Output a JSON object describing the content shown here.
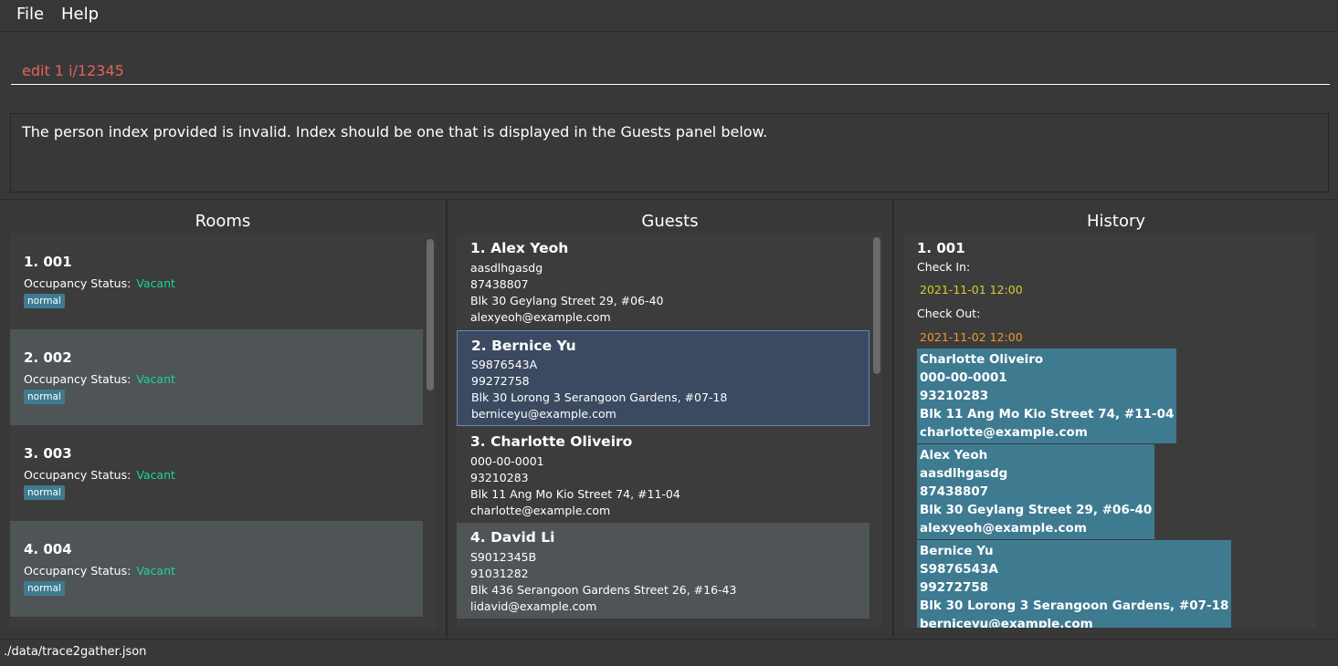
{
  "menu": {
    "file": "File",
    "help": "Help"
  },
  "command": {
    "value": "edit 1 i/12345"
  },
  "result": {
    "message": "The person index provided is invalid. Index should be one that is displayed in the Guests panel below."
  },
  "panels": {
    "rooms": "Rooms",
    "guests": "Guests",
    "history": "History"
  },
  "rooms": [
    {
      "title": "1.  001",
      "occupancy_label": "Occupancy Status:",
      "occupancy_value": "Vacant",
      "tag": "normal"
    },
    {
      "title": "2.  002",
      "occupancy_label": "Occupancy Status:",
      "occupancy_value": "Vacant",
      "tag": "normal"
    },
    {
      "title": "3.  003",
      "occupancy_label": "Occupancy Status:",
      "occupancy_value": "Vacant",
      "tag": "normal"
    },
    {
      "title": "4.  004",
      "occupancy_label": "Occupancy Status:",
      "occupancy_value": "Vacant",
      "tag": "normal"
    }
  ],
  "guests": [
    {
      "name": "1.  Alex Yeoh",
      "id": "aasdlhgasdg",
      "phone": "87438807",
      "address": "Blk 30 Geylang Street 29, #06-40",
      "email": "alexyeoh@example.com"
    },
    {
      "name": "2.  Bernice Yu",
      "id": "S9876543A",
      "phone": "99272758",
      "address": "Blk 30 Lorong 3 Serangoon Gardens, #07-18",
      "email": "berniceyu@example.com"
    },
    {
      "name": "3.  Charlotte Oliveiro",
      "id": "000-00-0001",
      "phone": "93210283",
      "address": "Blk 11 Ang Mo Kio Street 74, #11-04",
      "email": "charlotte@example.com"
    },
    {
      "name": "4.  David Li",
      "id": "S9012345B",
      "phone": "91031282",
      "address": "Blk 436 Serangoon Gardens Street 26, #16-43",
      "email": "lidavid@example.com"
    }
  ],
  "history": {
    "title": "1.  001",
    "check_in_label": "Check In:",
    "check_in": "2021-11-01 12:00",
    "check_out_label": "Check Out:",
    "check_out": "2021-11-02 12:00",
    "guests": [
      {
        "name": "Charlotte Oliveiro",
        "id": "000-00-0001",
        "phone": "93210283",
        "address": "Blk 11 Ang Mo Kio Street 74, #11-04",
        "email": "charlotte@example.com"
      },
      {
        "name": "Alex Yeoh",
        "id": "aasdlhgasdg",
        "phone": "87438807",
        "address": "Blk 30 Geylang Street 29, #06-40",
        "email": "alexyeoh@example.com"
      },
      {
        "name": "Bernice Yu",
        "id": "S9876543A",
        "phone": "99272758",
        "address": "Blk 30 Lorong 3 Serangoon Gardens, #07-18",
        "email": "berniceyu@example.com"
      }
    ]
  },
  "status": {
    "path": "./data/trace2gather.json"
  },
  "colors": {
    "background": "#383838",
    "accent": "#3e7b91",
    "vacant": "#1fd1a0",
    "check_in": "#d2ce2e",
    "check_out": "#e89a2b",
    "command_text": "#e0645a"
  }
}
